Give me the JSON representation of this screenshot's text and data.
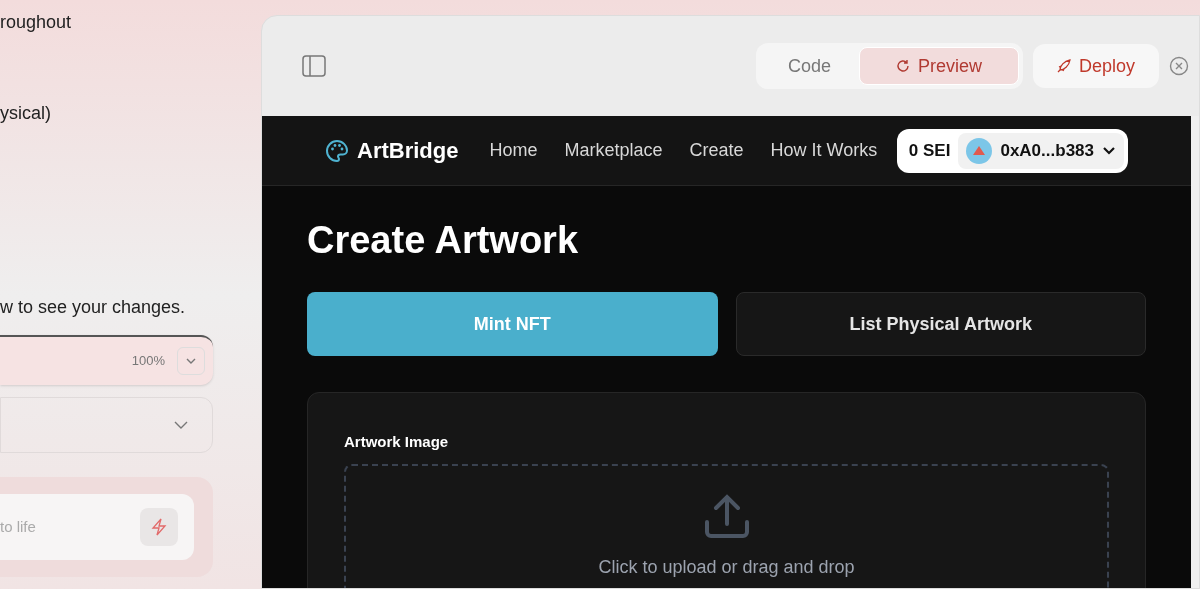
{
  "chat_panel": {
    "lines": [
      "roughout",
      "ysical)",
      "w to see your changes."
    ],
    "zoom_select": {
      "value": "100%"
    },
    "prompt": {
      "placeholder": "to life"
    }
  },
  "toolbar": {
    "tabs": [
      {
        "label": "Code",
        "selected": false
      },
      {
        "label": "Preview",
        "selected": true
      }
    ],
    "deploy": "Deploy"
  },
  "site": {
    "brand": "ArtBridge",
    "nav": [
      {
        "label": "Home"
      },
      {
        "label": "Marketplace"
      },
      {
        "label": "Create"
      },
      {
        "label": "How It Works"
      }
    ],
    "balance": "0 SEI",
    "address": "0xA0...b383",
    "heading": "Create Artwork",
    "tabs": [
      {
        "label": "Mint NFT",
        "selected": true
      },
      {
        "label": "List Physical Artwork",
        "selected": false
      }
    ],
    "field_label": "Artwork Image",
    "dropzone_text": "Click to upload or drag and drop"
  }
}
